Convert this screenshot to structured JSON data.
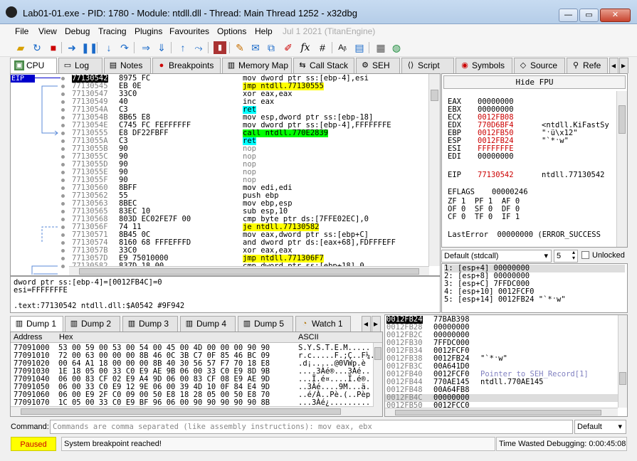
{
  "window": {
    "title": "Lab01-01.exe - PID: 1780 - Module: ntdll.dll - Thread: Main Thread 1252 - x32dbg",
    "minimize": "—",
    "maximize": "▭",
    "close": "✕"
  },
  "menu": [
    {
      "label": "File"
    },
    {
      "label": "View"
    },
    {
      "label": "Debug"
    },
    {
      "label": "Tracing"
    },
    {
      "label": "Plugins"
    },
    {
      "label": "Favourites"
    },
    {
      "label": "Options"
    },
    {
      "label": "Help"
    },
    {
      "label": "Jul 1 2021 (TitanEngine)"
    }
  ],
  "tabs": [
    {
      "label": "CPU",
      "icon": "cpu-icon"
    },
    {
      "label": "Log",
      "icon": "log-icon"
    },
    {
      "label": "Notes",
      "icon": "notes-icon"
    },
    {
      "label": "Breakpoints",
      "icon": "breakpoint-icon"
    },
    {
      "label": "Memory Map",
      "icon": "memory-map-icon"
    },
    {
      "label": "Call Stack",
      "icon": "call-stack-icon"
    },
    {
      "label": "SEH",
      "icon": "seh-icon"
    },
    {
      "label": "Script",
      "icon": "script-icon"
    },
    {
      "label": "Symbols",
      "icon": "symbols-icon"
    },
    {
      "label": "Source",
      "icon": "source-icon"
    },
    {
      "label": "Refe",
      "icon": "references-icon"
    }
  ],
  "disasm": {
    "eip_label": "EIP",
    "rows": [
      {
        "addr": "77130542",
        "bytes": "8975 FC",
        "instr": "mov dword ptr ss:[ebp-4],esi"
      },
      {
        "addr": "77130545",
        "bytes": "EB 0E",
        "instr": "jmp ntdll.77130555"
      },
      {
        "addr": "77130547",
        "bytes": "33C0",
        "instr": "xor eax,eax"
      },
      {
        "addr": "77130549",
        "bytes": "40",
        "instr": "inc eax"
      },
      {
        "addr": "7713054A",
        "bytes": "C3",
        "instr": "ret"
      },
      {
        "addr": "7713054B",
        "bytes": "8B65 E8",
        "instr": "mov esp,dword ptr ss:[ebp-18]"
      },
      {
        "addr": "7713054E",
        "bytes": "C745 FC FEFFFFFF",
        "instr": "mov dword ptr ss:[ebp-4],FFFFFFFE"
      },
      {
        "addr": "77130555",
        "bytes": "E8 DF22FBFF",
        "instr": "call ntdll.770E2839"
      },
      {
        "addr": "7713055A",
        "bytes": "C3",
        "instr": "ret"
      },
      {
        "addr": "7713055B",
        "bytes": "90",
        "instr": "nop"
      },
      {
        "addr": "7713055C",
        "bytes": "90",
        "instr": "nop"
      },
      {
        "addr": "7713055D",
        "bytes": "90",
        "instr": "nop"
      },
      {
        "addr": "7713055E",
        "bytes": "90",
        "instr": "nop"
      },
      {
        "addr": "7713055F",
        "bytes": "90",
        "instr": "nop"
      },
      {
        "addr": "77130560",
        "bytes": "8BFF",
        "instr": "mov edi,edi"
      },
      {
        "addr": "77130562",
        "bytes": "55",
        "instr": "push ebp"
      },
      {
        "addr": "77130563",
        "bytes": "8BEC",
        "instr": "mov ebp,esp"
      },
      {
        "addr": "77130565",
        "bytes": "83EC 10",
        "instr": "sub esp,10"
      },
      {
        "addr": "77130568",
        "bytes": "803D EC02FE7F 00",
        "instr": "cmp byte ptr ds:[7FFE02EC],0"
      },
      {
        "addr": "7713056F",
        "bytes": "74 11",
        "instr": "je ntdll.77130582"
      },
      {
        "addr": "77130571",
        "bytes": "8B45 0C",
        "instr": "mov eax,dword ptr ss:[ebp+C]"
      },
      {
        "addr": "77130574",
        "bytes": "8160 68 FFFEFFFD",
        "instr": "and dword ptr ds:[eax+68],FDFFFEFF"
      },
      {
        "addr": "7713057B",
        "bytes": "33C0",
        "instr": "xor eax,eax"
      },
      {
        "addr": "7713057D",
        "bytes": "E9 75010000",
        "instr": "jmp ntdll.771306F7"
      },
      {
        "addr": "77130582",
        "bytes": "837D 18 00",
        "instr": "cmp dword ptr ss:[ebp+18],0"
      }
    ]
  },
  "info": {
    "line1": "dword ptr ss:[ebp-4]=[0012FB4C]=0",
    "line2": "esi=FFFFFFFE",
    "line3": "",
    "line4": ".text:77130542 ntdll.dll:$A0542 #9F942"
  },
  "registers": {
    "hide_fpu": "Hide FPU",
    "gp": [
      {
        "name": "EAX",
        "value": "00000000",
        "comment": ""
      },
      {
        "name": "EBX",
        "value": "00000000",
        "comment": ""
      },
      {
        "name": "ECX",
        "value": "0012FB08",
        "comment": ""
      },
      {
        "name": "EDX",
        "value": "770D6BF4",
        "comment": "<ntdll.KiFastSy"
      },
      {
        "name": "EBP",
        "value": "0012FB50",
        "comment": "\"ˑü\\x12\""
      },
      {
        "name": "ESP",
        "value": "0012FB24",
        "comment": "\"`*ˑw\""
      },
      {
        "name": "ESI",
        "value": "FFFFFFFE",
        "comment": ""
      },
      {
        "name": "EDI",
        "value": "00000000",
        "comment": ""
      }
    ],
    "eip": {
      "name": "EIP",
      "value": "77130542",
      "comment": "ntdll.77130542"
    },
    "eflags": {
      "name": "EFLAGS",
      "value": "00000246"
    },
    "flags_rows": [
      "ZF 1  PF 1  AF 0",
      "OF 0  SF 0  DF 0",
      "CF 0  TF 0  IF 1"
    ],
    "last_error": "LastError  00000000 (ERROR_SUCCESS"
  },
  "callconv": {
    "selected": "Default (stdcall)",
    "arg_count": "5",
    "unlocked_label": "Unlocked"
  },
  "args": [
    "1: [esp+4] 00000000",
    "2: [esp+8] 00000000",
    "3: [esp+C] 7FFDC000",
    "4: [esp+10] 0012FCF0",
    "5: [esp+14] 0012FB24 \"`*ˑw\""
  ],
  "dump_tabs": [
    {
      "label": "Dump 1"
    },
    {
      "label": "Dump 2"
    },
    {
      "label": "Dump 3"
    },
    {
      "label": "Dump 4"
    },
    {
      "label": "Dump 5"
    },
    {
      "label": "Watch 1"
    }
  ],
  "dump": {
    "header": {
      "address": "Address",
      "hex": "Hex",
      "ascii": "ASCII"
    },
    "rows": [
      {
        "addr": "77091000",
        "hex": "53 00 59 00 53 00 54 00 45 00 4D 00 00 00 90 90",
        "ascii": "S.Y.S.T.E.M....."
      },
      {
        "addr": "77091010",
        "hex": "72 00 63 00 00 00 8B 46 0C 3B C7 0F 85 46 BC 09",
        "ascii": "r.c.....F.;Ç..F¼."
      },
      {
        "addr": "77091020",
        "hex": "00 64 A1 18 00 00 00 8B 40 30 56 57 F7 70 18 E8",
        "ascii": ".d¡.....@0VWp.è"
      },
      {
        "addr": "77091030",
        "hex": "1E 18 05 00 33 C0 E9 AE 9B 06 00 33 C0 E9 8D 9B",
        "ascii": "....3Àé®...3Àé.."
      },
      {
        "addr": "77091040",
        "hex": "06 00 83 CF 02 E9 A4 9D 06 00 83 CF 08 E9 AE 9D",
        "ascii": "...Ï.é¤....Ï.é®."
      },
      {
        "addr": "77091050",
        "hex": "06 00 33 C0 E9 12 9E 06 00 39 4D 10 0F 84 E4 9D",
        "ascii": "..3Àé....9M...ä."
      },
      {
        "addr": "77091060",
        "hex": "06 00 E9 2F C0 09 00 50 E8 18 28 05 00 50 E8 70",
        "ascii": "..é/À..Pè.(..Pèp"
      },
      {
        "addr": "77091070",
        "hex": "1C 05 00 33 C0 E9 BF 96 06 00 90 90 90 90 90 8B",
        "ascii": "...3Àé¿........."
      }
    ]
  },
  "stack": {
    "rows": [
      {
        "addr": "0012FB24",
        "value": "77BAB398",
        "comment": ""
      },
      {
        "addr": "0012FB28",
        "value": "00000000",
        "comment": ""
      },
      {
        "addr": "0012FB2C",
        "value": "00000000",
        "comment": ""
      },
      {
        "addr": "0012FB30",
        "value": "7FFDC000",
        "comment": ""
      },
      {
        "addr": "0012FB34",
        "value": "0012FCF0",
        "comment": ""
      },
      {
        "addr": "0012FB38",
        "value": "0012FB24",
        "comment": "\"`*ˑw\""
      },
      {
        "addr": "0012FB3C",
        "value": "00A641D0",
        "comment": ""
      },
      {
        "addr": "0012FB40",
        "value": "0012FCF0",
        "comment": "Pointer to SEH_Record[1]"
      },
      {
        "addr": "0012FB44",
        "value": "770AE145",
        "comment": "ntdll.770AE145"
      },
      {
        "addr": "0012FB48",
        "value": "00A64FB8",
        "comment": ""
      },
      {
        "addr": "0012FB4C",
        "value": "00000000",
        "comment": ""
      },
      {
        "addr": "0012FB50",
        "value": "0012FCC0",
        "comment": ""
      }
    ]
  },
  "command": {
    "label": "Command:",
    "placeholder": "Commands are comma separated (like assembly instructions): mov eax, ebx",
    "mode": "Default"
  },
  "status": {
    "state": "Paused",
    "message": "System breakpoint reached!",
    "time_wasted": "Time Wasted Debugging: 0:00:45:08"
  },
  "colors": {
    "paused_bg": "#ffff00",
    "paused_fg": "#cc0000",
    "eip_bg": "#0000cc",
    "jump_highlight": "#ffff00",
    "call_highlight": "#00ff00",
    "ret_highlight": "#00ffff"
  }
}
